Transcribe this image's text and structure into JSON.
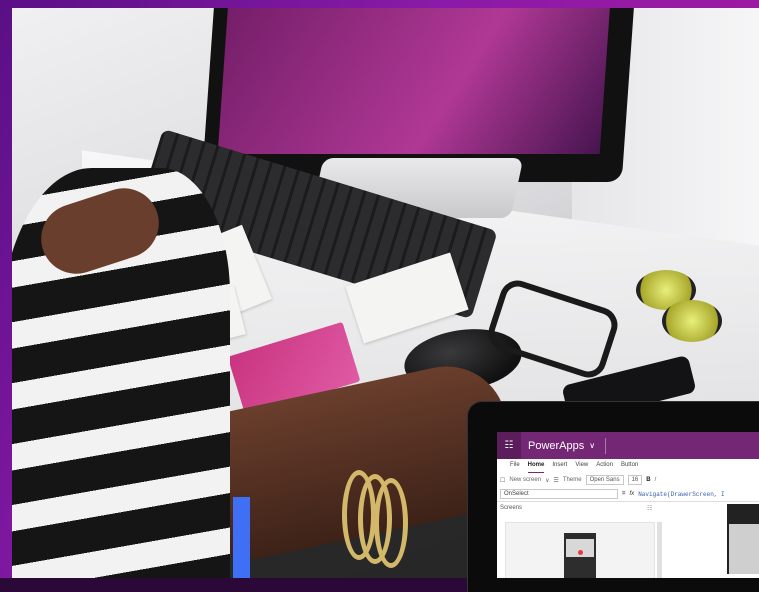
{
  "app": {
    "name": "PowerApps",
    "tabs": [
      "File",
      "Home",
      "Insert",
      "View",
      "Action",
      "Button"
    ],
    "active_tab": "Home"
  },
  "toolbar": {
    "new_screen": "New screen",
    "themes": "Theme",
    "font": "Open Sans",
    "font_size": "16",
    "bold": "B",
    "italic": "/"
  },
  "formula": {
    "property": "OnSelect",
    "equals": "=",
    "fx": "fx",
    "expression": "Navigate(DrawerScreen, I"
  },
  "panel": {
    "screens_label": "Screens"
  },
  "colors": {
    "frame_gradient_start": "#5a0f86",
    "frame_gradient_end": "#b0189a",
    "app_bar": "#742774",
    "accent_bar": "#3f6ff5"
  }
}
